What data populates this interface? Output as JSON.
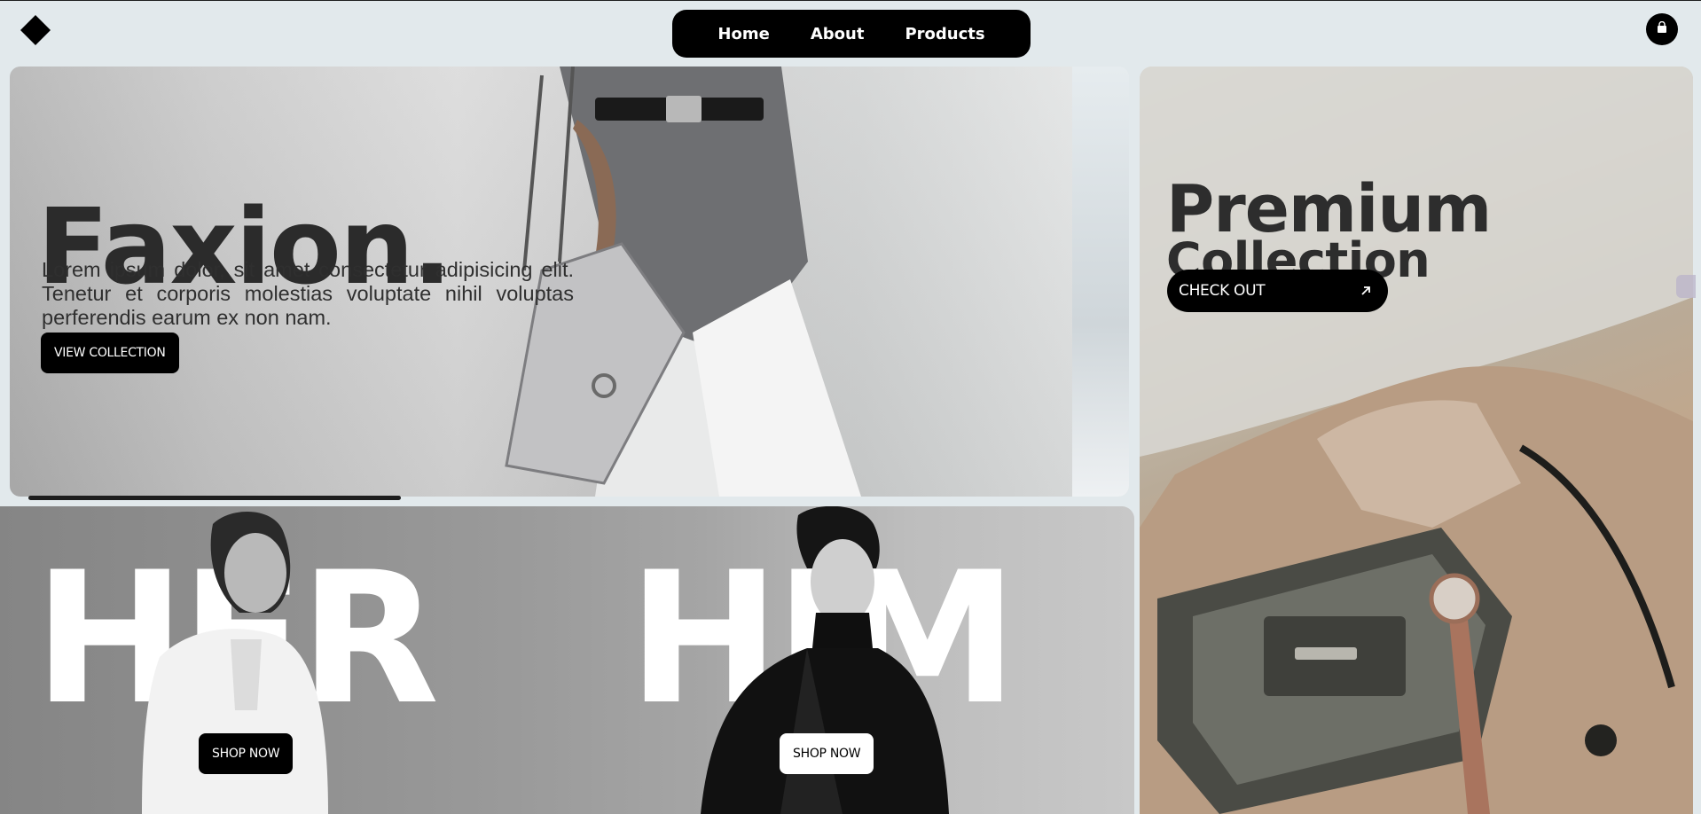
{
  "nav": {
    "items": [
      {
        "label": "Home"
      },
      {
        "label": "About"
      },
      {
        "label": "Products"
      }
    ]
  },
  "icons": {
    "logo": "diamond-logo-icon",
    "cart": "shopping-bag-icon",
    "arrow": "arrow-up-right-icon"
  },
  "hero": {
    "title": "Faxion.",
    "description": "Lorem ipsum dolor, sit amet consectetur adipisicing elit. Tenetur et corporis molestias voluptate nihil voluptas perferendis earum ex non nam.",
    "button_label": "VIEW COLLECTION"
  },
  "premium": {
    "title": "Premium",
    "subtitle": "Collection",
    "button_label": "CHECK OUT"
  },
  "categories": [
    {
      "word": "HER",
      "button_label": "SHOP NOW"
    },
    {
      "word": "HIM",
      "button_label": "SHOP NOW"
    }
  ],
  "colors": {
    "page_bg": "#e2e9ec",
    "accent": "#000000",
    "button_text": "#ffffff"
  }
}
